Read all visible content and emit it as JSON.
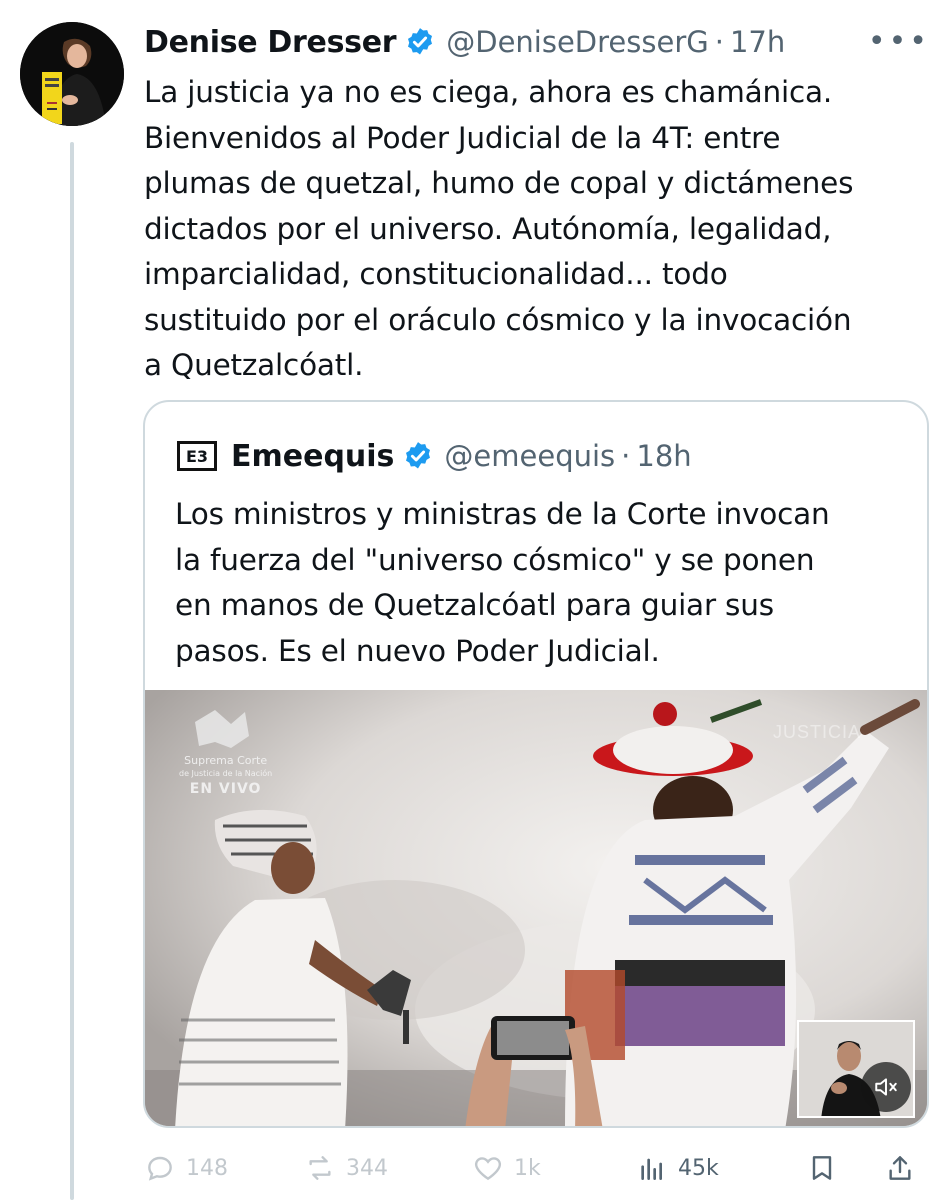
{
  "tweet": {
    "author_name": "Denise Dresser",
    "handle": "@DeniseDresserG",
    "separator": "·",
    "time": "17h",
    "text": "La justicia ya no es ciega, ahora es chamánica.\nBienvenidos al Poder Judicial de la 4T: entre\nplumas de quetzal, humo de copal y dictámenes\ndictados por el universo. Autónomía, legalidad,\nimparcialidad, constitucionalidad... todo\nsustituido por el oráculo cósmico y la invocación\na Quetzalcóatl.",
    "more_icon": "more-dots-icon"
  },
  "quote": {
    "logo_text": "E3",
    "author_name": "Emeequis",
    "handle": "@emeequis",
    "separator": "·",
    "time": "18h",
    "text": "Los ministros y ministras de la Corte invocan\nla fuerza del \"universo cósmico\" y se ponen\nen manos de Quetzalcóatl para guiar sus\npasos. Es el nuevo Poder Judicial.",
    "media": {
      "watermark_line1": "Suprema Corte",
      "watermark_line2": "de Justicia de la Nación",
      "watermark_live": "EN VIVO",
      "corner_text": "JUSTICIA"
    }
  },
  "actions": {
    "replies": "148",
    "reposts": "344",
    "likes": "1k",
    "views": "45k"
  },
  "colors": {
    "verified_blue": "#1d9bf0",
    "secondary_text": "#536471",
    "border": "#cfd9de"
  }
}
